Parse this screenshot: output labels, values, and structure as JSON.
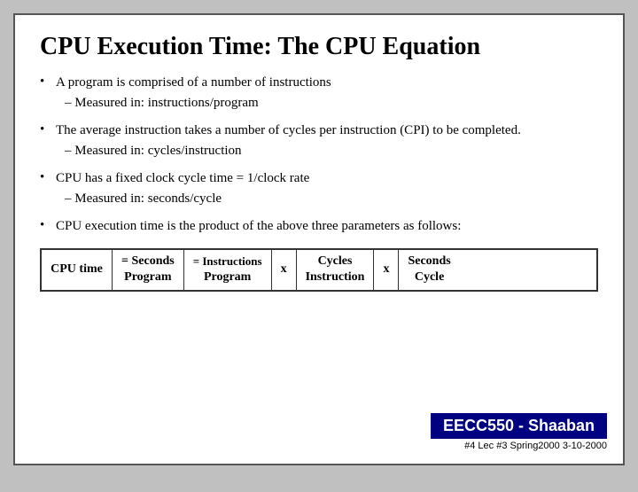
{
  "slide": {
    "title": "CPU Execution Time: The CPU Equation",
    "bullets": [
      {
        "id": "b1",
        "text": "A program is comprised of a number of instructions",
        "sub": "–  Measured in:       instructions/program"
      },
      {
        "id": "b2",
        "text": "The average instruction takes a number of cycles per instruction (CPI) to be completed.",
        "sub": "–  Measured in:   cycles/instruction"
      },
      {
        "id": "b3",
        "text": "CPU has a fixed clock cycle time = 1/clock rate",
        "sub": "–  Measured in:       seconds/cycle"
      },
      {
        "id": "b4",
        "text": "CPU execution time is the product of the above three parameters as follows:",
        "sub": null
      }
    ],
    "equation": {
      "label_line1": "CPU time",
      "label_line2": "",
      "eq1_line1": "=  Seconds",
      "eq1_line2": "Program",
      "eq2_line1": "= Instructions",
      "eq2_line2": "Program",
      "op1": "x",
      "eq3_line1": "Cycles",
      "eq3_line2": "Instruction",
      "op2": "x",
      "eq4_line1": "Seconds",
      "eq4_line2": "Cycle"
    },
    "footer": {
      "badge": "EECC550 - Shaaban",
      "sub": "#4   Lec #3   Spring2000   3-10-2000"
    }
  }
}
